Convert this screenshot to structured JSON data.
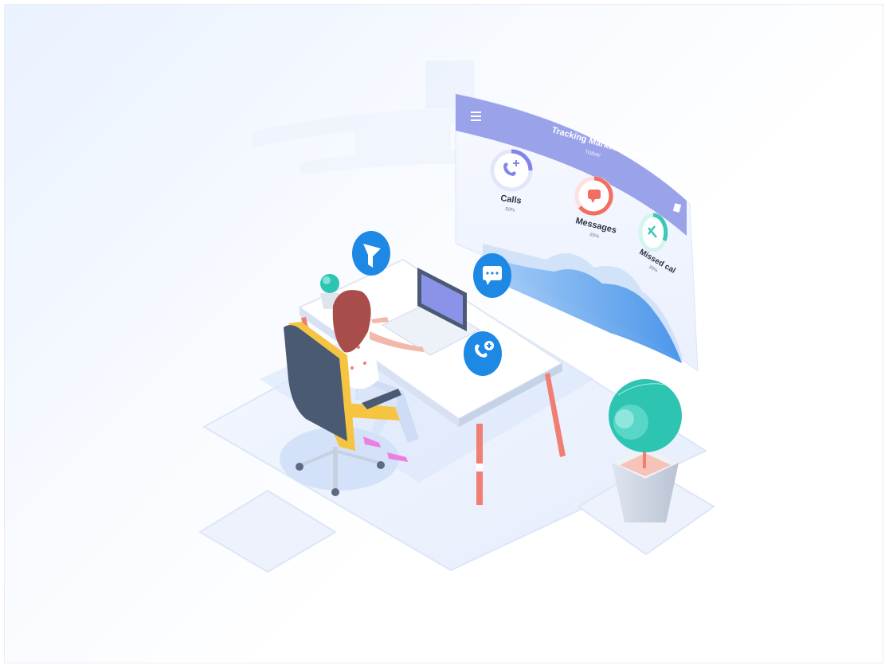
{
  "dashboard": {
    "title": "Tracking Marketing ROI",
    "subtitle": "TODAY",
    "menu_icon": "hamburger-menu-icon",
    "stats": [
      {
        "label": "Calls",
        "value": "50%",
        "icon": "phone-plus-icon",
        "color": "#7f86e8"
      },
      {
        "label": "Messages",
        "value": "65%",
        "icon": "chat-bubble-icon",
        "color": "#f26d63"
      },
      {
        "label": "Missed cal",
        "value": "30%",
        "icon": "phone-missed-icon",
        "color": "#3cc8b4"
      }
    ]
  },
  "floating_icons": [
    {
      "name": "funnel-icon",
      "color": "#1e88e5"
    },
    {
      "name": "chat-icon",
      "color": "#1e88e5"
    },
    {
      "name": "phone-add-icon",
      "color": "#1e88e5"
    }
  ],
  "colors": {
    "accent": "#1e88e5",
    "panel_header": "#9aa3ea",
    "plant": "#2ec4b2",
    "chair": "#f5c542",
    "desk_leg": "#f07e72"
  }
}
